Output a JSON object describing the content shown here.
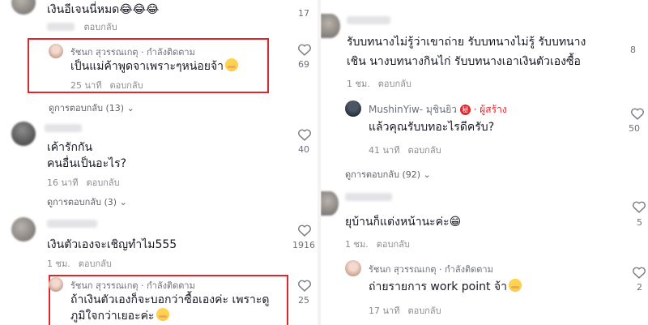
{
  "left": {
    "top_comment": {
      "text": "เงินอีเจนนี่หมด",
      "emoji": "😂😂😂",
      "likes": "17"
    },
    "c1": {
      "author": "รัชนก สุวรรณเกตุ · กำลังติดตาม",
      "text": "เป็นแม่ค้าพูดจาเพราะๆหน่อยจ้า",
      "time": "25 นาที",
      "reply": "ตอบกลับ",
      "likes": "69",
      "view_replies": "ดูการตอบกลับ (13)"
    },
    "c2": {
      "text_line1": "เค้ารักกัน",
      "text_line2": "คนอื่นเป็นอะไร?",
      "time": "16 นาที",
      "reply": "ตอบกลับ",
      "likes": "40",
      "view_replies": "ดูการตอบกลับ (3)"
    },
    "c3": {
      "text": "เงินตัวเองจะเชิญทำไม555",
      "time": "1 ชม.",
      "reply": "ตอบกลับ",
      "likes": "1916"
    },
    "c4": {
      "author": "รัชนก สุวรรณเกตุ · กำลังติดตาม",
      "text_line1": "ถ้าเงินตัวเองก็จะบอกว่าซื้อเองค่ะ เพราะดู",
      "text_line2": "ภูมิใจกว่าเยอะค่ะ",
      "likes": "25"
    }
  },
  "right": {
    "c1": {
      "text_line1": "รับบทนางไม่รู้ว่าเขาถ่าย รับบทนางไม่รู้ รับบทนาง",
      "text_line2": "เชิน นางบทนางกินไก่ รับบทนางเอาเงินตัวเองซื้อ",
      "time": "1 ชม.",
      "reply": "ตอบกลับ",
      "likes": "8"
    },
    "c1_reply": {
      "author": "MushinYiw- มุชินยิว",
      "badge": "秘",
      "creator": "· ผู้สร้าง",
      "text": "แล้วคุณรับบทอะไรดีครับ?",
      "time": "41 นาที",
      "reply": "ตอบกลับ",
      "likes": "50"
    },
    "c1_view_replies": "ดูการตอบกลับ (92)",
    "c2": {
      "text": "ยุบ้านก็แต่งหน้านะค่ะ",
      "emoji": "😁",
      "time": "1 ชม.",
      "reply": "ตอบกลับ",
      "likes": "5"
    },
    "c2_reply": {
      "author": "รัชนก สุวรรณเกตุ · กำลังติดตาม",
      "text": "ถ่ายรายการ work point จ้า",
      "time": "17 นาที",
      "reply": "ตอบกลับ",
      "likes": "2"
    }
  },
  "colors": {
    "highlight": "#e0262b",
    "creator": "#e0262b",
    "text": "#161823",
    "meta": "#8a8b91"
  }
}
